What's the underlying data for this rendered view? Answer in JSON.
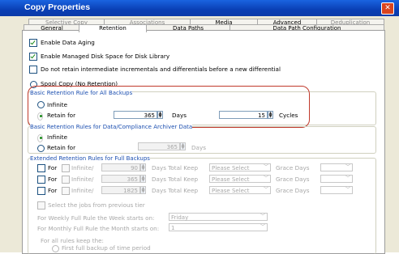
{
  "window": {
    "title": "Copy Properties",
    "close_label": "✕"
  },
  "tabs_row1": [
    {
      "label": "Selective Copy",
      "state": "disabled"
    },
    {
      "label": "Associations",
      "state": "disabled"
    },
    {
      "label": "Media",
      "state": "enabled"
    },
    {
      "label": "Advanced",
      "state": "enabled"
    },
    {
      "label": "Deduplication",
      "state": "disabled"
    }
  ],
  "tabs_row2": [
    {
      "label": "General",
      "state": "enabled"
    },
    {
      "label": "Retention",
      "state": "active"
    },
    {
      "label": "Data Paths",
      "state": "enabled"
    },
    {
      "label": "Data Path Configuration",
      "state": "enabled"
    }
  ],
  "options": {
    "enable_data_aging": "Enable Data Aging",
    "enable_managed_disk": "Enable Managed Disk Space for Disk Library",
    "do_not_retain": "Do not retain intermediate incrementals and differentials before a new differential",
    "spool_copy": "Spool Copy (No Retention)"
  },
  "basic_retention": {
    "title": "Basic Retention Rule for All Backups",
    "infinite_label": "Infinite",
    "retain_for_label": "Retain for",
    "days_value": "365",
    "days_label": "Days",
    "cycles_value": "15",
    "cycles_label": "Cycles"
  },
  "archiver_retention": {
    "title": "Basic Retention Rules for Data/Compliance Archiver Data",
    "infinite_label": "Infinite",
    "retain_for_label": "Retain for",
    "days_value": "365",
    "days_label": "Days"
  },
  "extended_retention": {
    "title": "Extended Retention Rules for Full Backups",
    "rows": [
      {
        "for_label": "For",
        "infinite_label": "Infinite/",
        "value": "90",
        "days_total_keep": "Days Total Keep",
        "select": "Please Select",
        "grace": "Grace Days"
      },
      {
        "for_label": "For",
        "infinite_label": "Infinite/",
        "value": "365",
        "days_total_keep": "Days Total Keep",
        "select": "Please Select",
        "grace": "Grace Days"
      },
      {
        "for_label": "For",
        "infinite_label": "Infinite/",
        "value": "1825",
        "days_total_keep": "Days Total Keep",
        "select": "Please Select",
        "grace": "Grace Days"
      }
    ],
    "select_jobs_label": "Select the jobs from previous tier",
    "weekly_label": "For Weekly Full Rule the Week starts on:",
    "weekly_value": "Friday",
    "monthly_label": "For Monthly Full Rule the Month starts on:",
    "monthly_value": "1",
    "all_rules_label": "For all rules keep the:",
    "first_full_label": "First full backup of time period"
  },
  "colors": {
    "accent_title": "#1c4fb0",
    "highlight_border": "#c0392b",
    "titlebar": "#0a3fb5"
  }
}
